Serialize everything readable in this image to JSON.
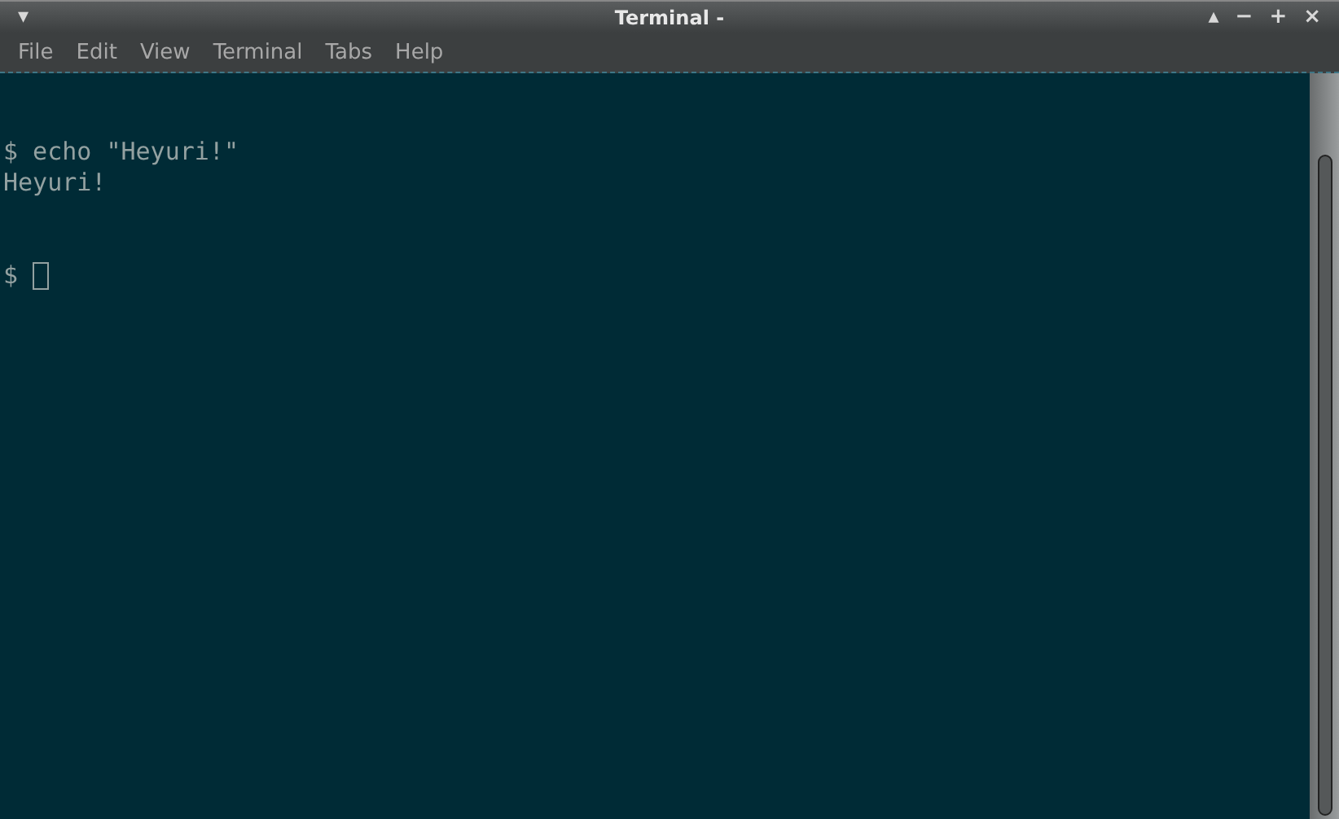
{
  "window": {
    "title": "Terminal -",
    "controls": [
      {
        "kind": "menu",
        "label": "▾"
      },
      {
        "kind": "shade",
        "label": "▴"
      },
      {
        "kind": "minimize",
        "label": "−"
      },
      {
        "kind": "maximize",
        "label": "+"
      },
      {
        "kind": "close",
        "label": "×"
      }
    ]
  },
  "menu": [
    "File",
    "Edit",
    "View",
    "Terminal",
    "Tabs",
    "Help"
  ],
  "terminal": {
    "lines": [
      "$ echo \"Heyuri!\"",
      "Heyuri!"
    ],
    "prompt": "$"
  }
}
